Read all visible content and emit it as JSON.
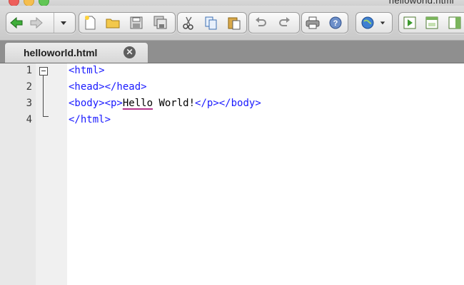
{
  "window": {
    "title": "helloworld.html"
  },
  "toolbar": {
    "buttons": [
      {
        "name": "back-icon"
      },
      {
        "name": "forward-icon"
      },
      {
        "name": "dropdown-icon"
      },
      {
        "name": "new-file-icon"
      },
      {
        "name": "open-folder-icon"
      },
      {
        "name": "save-icon"
      },
      {
        "name": "save-all-icon"
      },
      {
        "name": "cut-icon"
      },
      {
        "name": "copy-icon"
      },
      {
        "name": "paste-icon"
      },
      {
        "name": "undo-icon"
      },
      {
        "name": "redo-icon"
      },
      {
        "name": "print-icon"
      },
      {
        "name": "help-icon"
      },
      {
        "name": "globe-icon"
      },
      {
        "name": "run-icon"
      },
      {
        "name": "window-icon"
      },
      {
        "name": "panel-icon"
      }
    ]
  },
  "tabs": [
    {
      "label": "helloworld.html",
      "active": true
    }
  ],
  "editor": {
    "line_numbers": [
      "1",
      "2",
      "3",
      "4"
    ],
    "lines": [
      {
        "html_open": "<html>"
      },
      {
        "head": "<head></head>"
      },
      {
        "body_open": "<body><p>",
        "hello": "Hello",
        "world": " World!",
        "body_close": "</p></body>"
      },
      {
        "html_close": "</html>"
      }
    ],
    "colors": {
      "tag": "#1a1aff",
      "text": "#000000",
      "spell_underline": "#b5328c"
    }
  }
}
